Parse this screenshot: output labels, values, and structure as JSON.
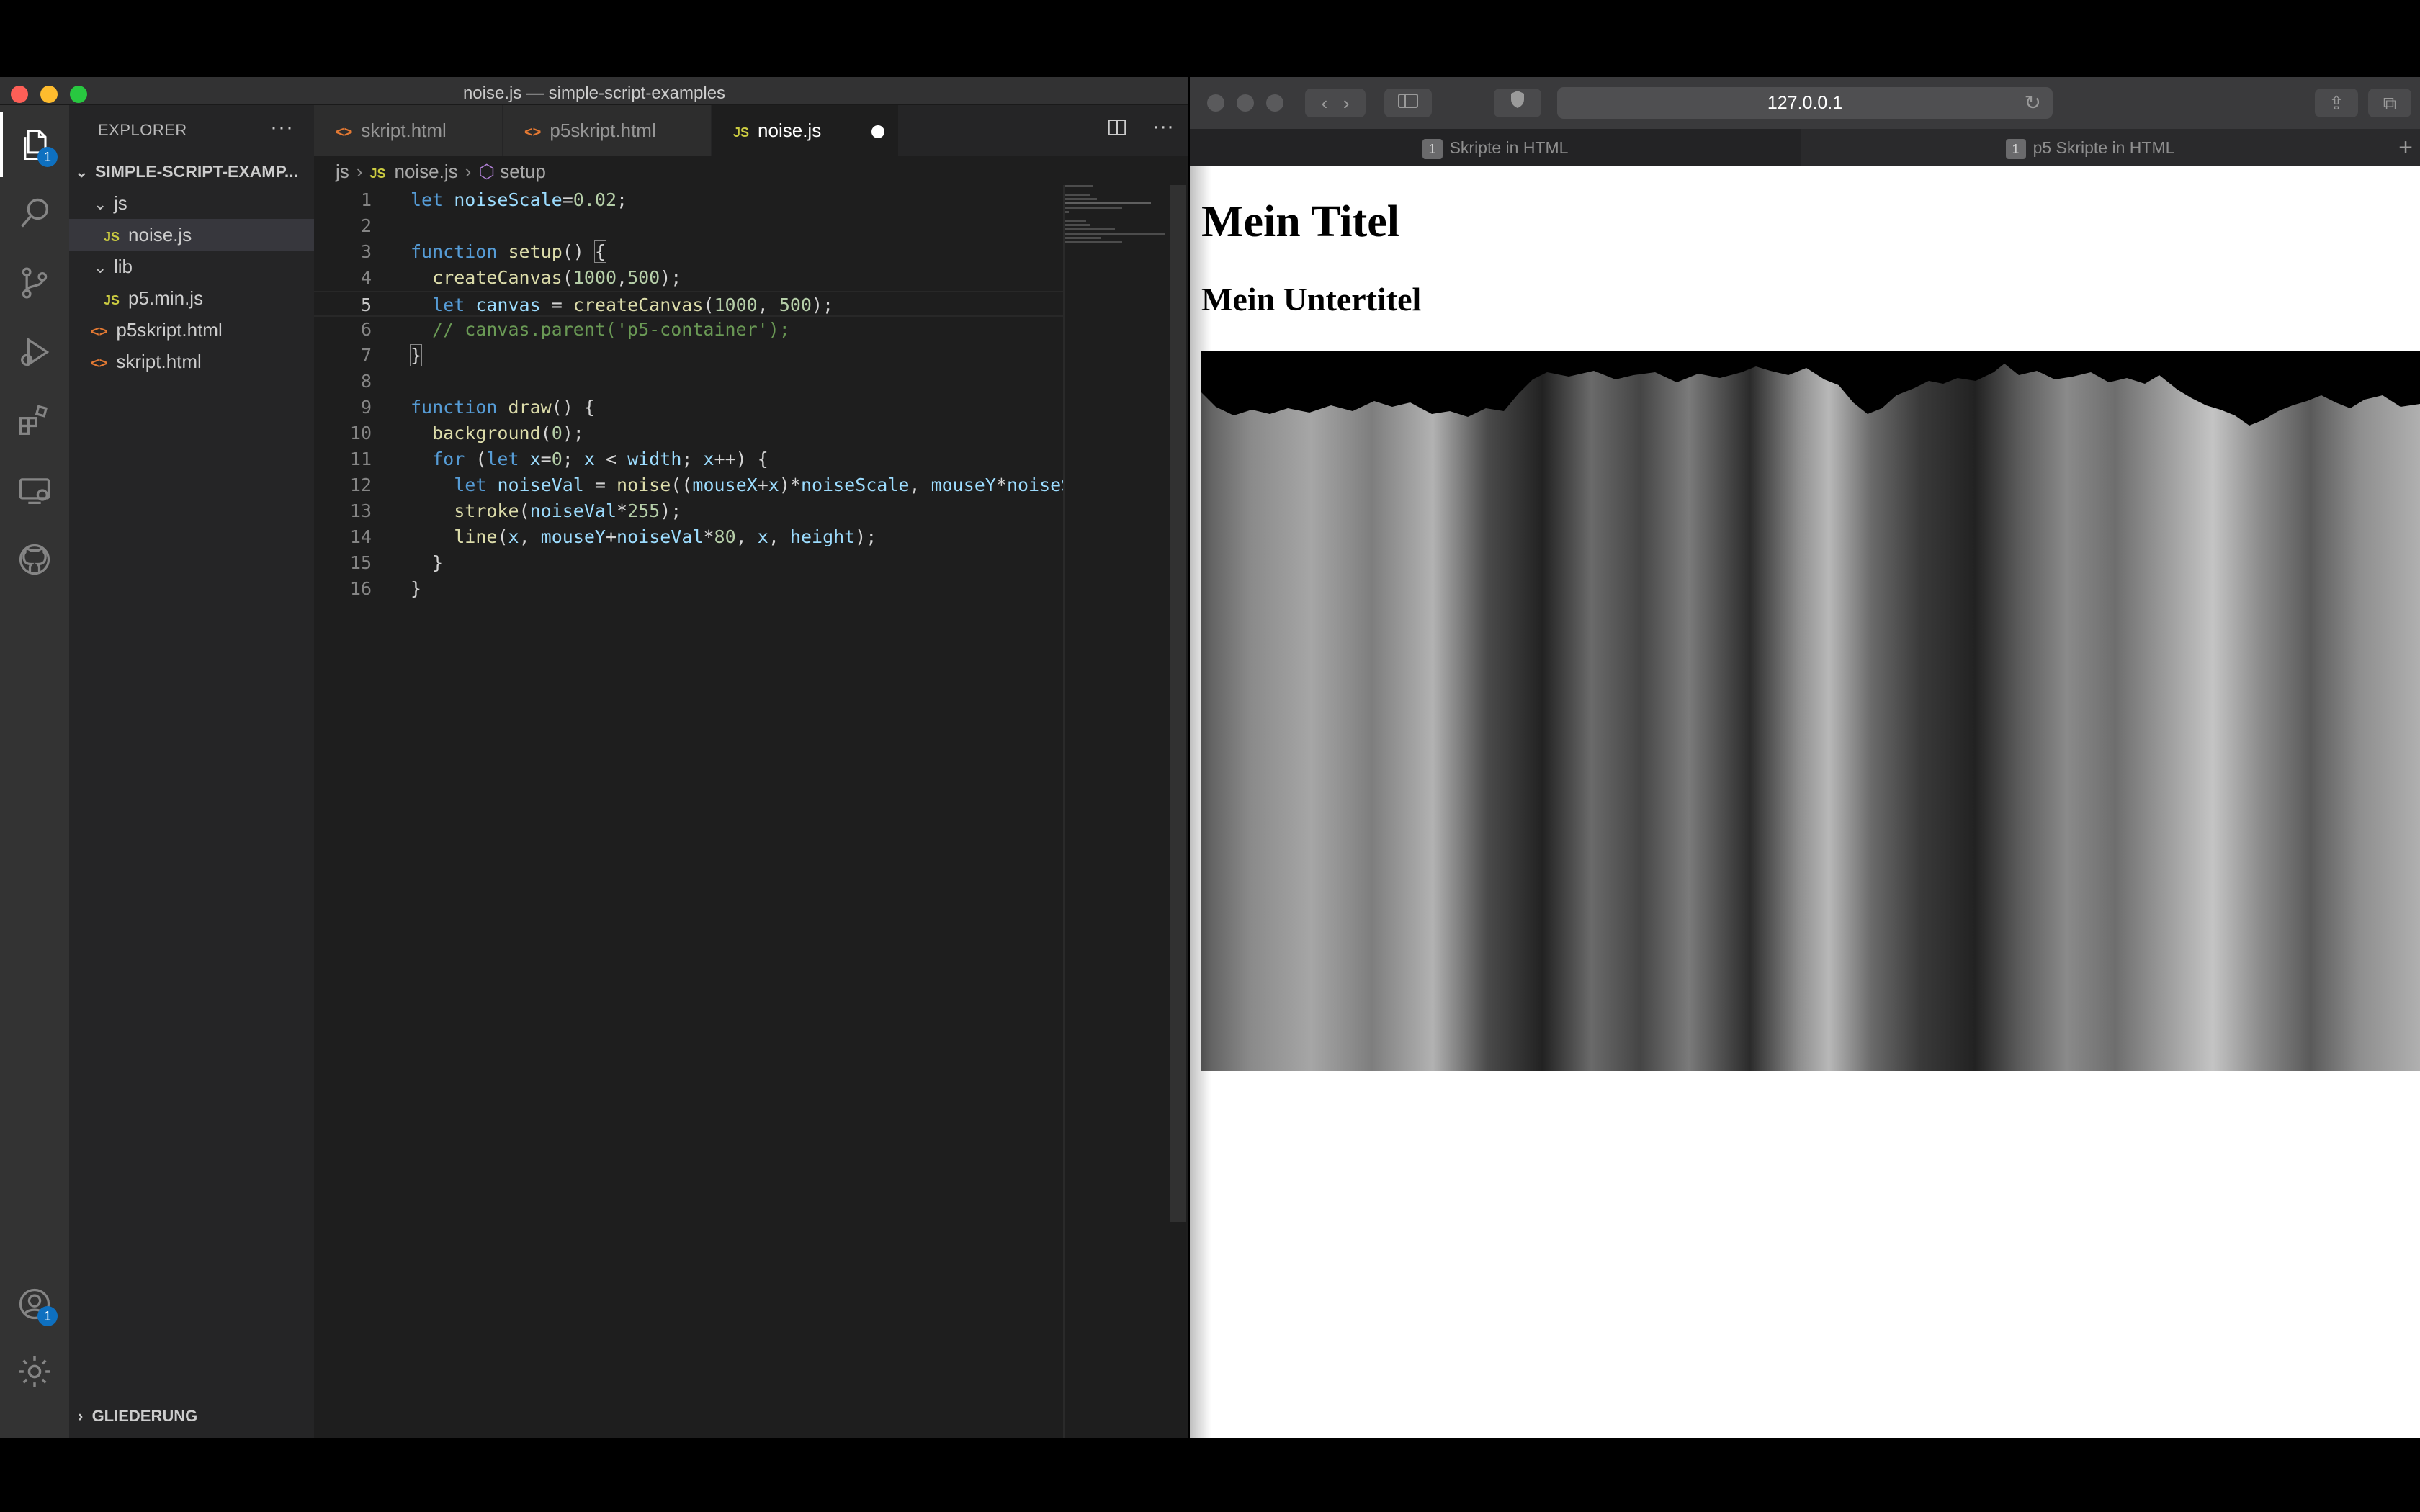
{
  "vscode": {
    "window_title": "noise.js — simple-script-examples",
    "explorer": {
      "header": "EXPLORER",
      "more": "···",
      "root": "SIMPLE-SCRIPT-EXAMP...",
      "folder_js": "js",
      "file_noise": "noise.js",
      "folder_lib": "lib",
      "file_p5min": "p5.min.js",
      "file_p5skript": "p5skript.html",
      "file_skript": "skript.html",
      "outline": "GLIEDERUNG",
      "js_badge": "JS",
      "html_badge": "<>"
    },
    "activity_badges": {
      "explorer": "1",
      "accounts": "1"
    },
    "tabs": [
      {
        "label": "skript.html"
      },
      {
        "label": "p5skript.html"
      },
      {
        "label": "noise.js"
      }
    ],
    "breadcrumb": {
      "folder": "js",
      "file": "noise.js",
      "symbol": "setup"
    },
    "code": {
      "line_numbers": [
        "1",
        "2",
        "3",
        "4",
        "5",
        "6",
        "7",
        "8",
        "9",
        "10",
        "11",
        "12",
        "13",
        "14",
        "15",
        "16"
      ]
    }
  },
  "safari": {
    "address": "127.0.0.1",
    "tabs": [
      {
        "num": "1",
        "label": "Skripte in HTML"
      },
      {
        "num": "1",
        "label": "p5 Skripte in HTML"
      }
    ],
    "page": {
      "title": "Mein Titel",
      "subtitle": "Mein Untertitel"
    }
  },
  "colors": {
    "editor_bg": "#1e1e1e",
    "sidebar_bg": "#252526",
    "activity_bg": "#333333",
    "keyword": "#569cd6",
    "function": "#dcdcaa",
    "number": "#b5cea8",
    "variable": "#9cdcfe",
    "comment": "#6a9955"
  },
  "icons": [
    "files-icon",
    "search-icon",
    "source-control-icon",
    "run-debug-icon",
    "extensions-icon",
    "remote-explorer-icon",
    "github-icon",
    "accounts-icon",
    "settings-gear-icon",
    "split-editor-icon",
    "sidebar-icon",
    "shield-icon",
    "reload-icon",
    "share-icon",
    "tabs-overview-icon"
  ]
}
